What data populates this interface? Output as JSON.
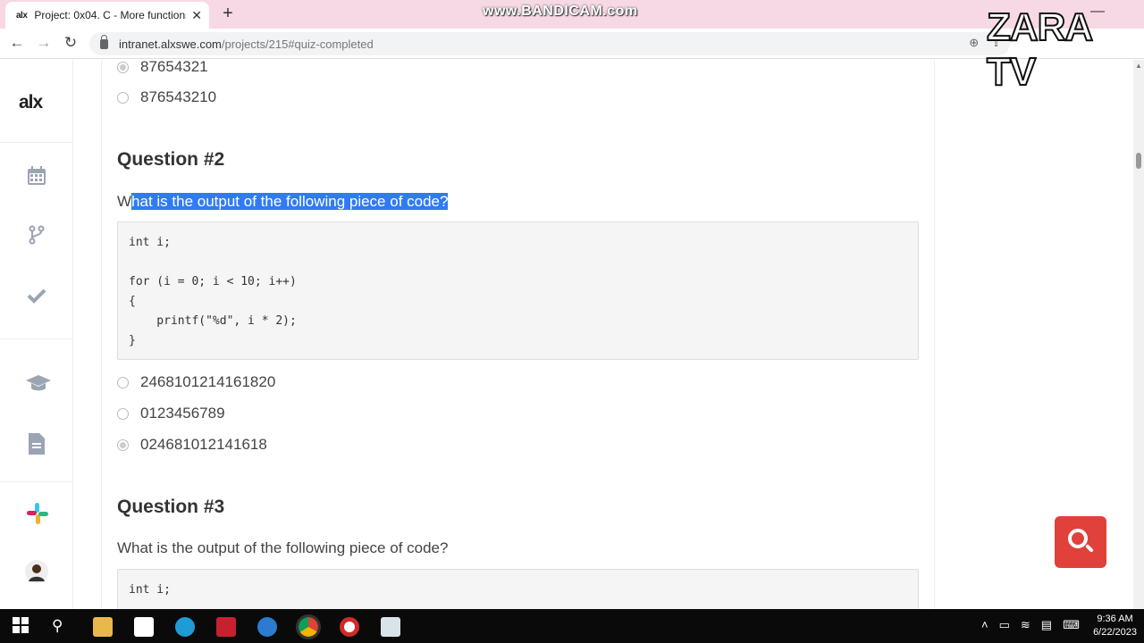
{
  "browser": {
    "tab_title": "Project: 0x04. C - More functions",
    "tab_favicon": "alx",
    "url_host": "intranet.alxswe.com",
    "url_path": "/projects/215#quiz-completed",
    "recorder_watermark": "www.BANDICAM.com",
    "channel_watermark": "ZARA TV"
  },
  "sidebar": {
    "logo": "alx",
    "icons": [
      "calendar-icon",
      "branch-icon",
      "check-icon",
      "graduation-cap-icon",
      "document-icon",
      "slack-icon",
      "user-avatar"
    ]
  },
  "quiz": {
    "prev_options": [
      {
        "text": "87654321",
        "checked": true
      },
      {
        "text": "876543210",
        "checked": false
      }
    ],
    "q2": {
      "title": "Question #2",
      "text_first": "W",
      "text_selected": "hat is the output of the following piece of code?",
      "code": "int i;\n\nfor (i = 0; i < 10; i++)\n{\n    printf(\"%d\", i * 2);\n}",
      "options": [
        {
          "text": "2468101214161820",
          "checked": false
        },
        {
          "text": "0123456789",
          "checked": false
        },
        {
          "text": "024681012141618",
          "checked": true
        }
      ]
    },
    "q3": {
      "title": "Question #3",
      "text": "What is the output of the following piece of code?",
      "code": "int i;"
    }
  },
  "taskbar": {
    "time": "9:36 AM",
    "date": "6/22/2023"
  },
  "colors": {
    "tab_strip": "#f6d9e4",
    "selection": "#2f7bf5",
    "search_button": "#e0413a"
  }
}
